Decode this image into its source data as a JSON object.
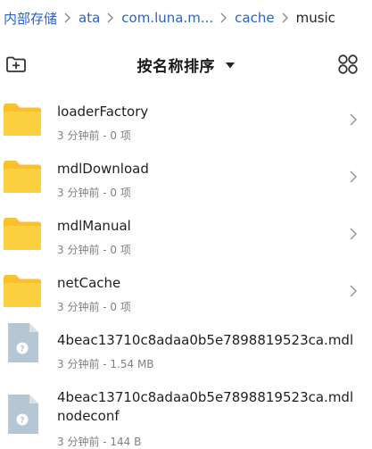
{
  "breadcrumb": [
    {
      "label": "内部存储"
    },
    {
      "label": "ata"
    },
    {
      "label": "com.luna.m..."
    },
    {
      "label": "cache"
    },
    {
      "label": "music"
    }
  ],
  "toolbar": {
    "new_folder_icon": "new-folder-icon",
    "sort_label": "按名称排序",
    "grid_view_icon": "grid-view-icon"
  },
  "items": [
    {
      "name": "loaderFactory",
      "meta": "3 分钟前 - 0 项",
      "type": "folder"
    },
    {
      "name": "mdlDownload",
      "meta": "3 分钟前 - 0 项",
      "type": "folder"
    },
    {
      "name": "mdlManual",
      "meta": "3 分钟前 - 0 项",
      "type": "folder"
    },
    {
      "name": "netCache",
      "meta": "3 分钟前 - 0 项",
      "type": "folder"
    },
    {
      "name": "4beac13710c8adaa0b5e7898819523ca.mdl",
      "meta": "3 分钟前 - 1.54 MB",
      "type": "file"
    },
    {
      "name": "4beac13710c8adaa0b5e7898819523ca.mdlnodeconf",
      "meta": "3 分钟前 - 144 B",
      "type": "file"
    }
  ],
  "colors": {
    "link": "#2a62c9",
    "folder": "#fbc02d",
    "file": "#b7c6d3",
    "meta": "#808080"
  }
}
